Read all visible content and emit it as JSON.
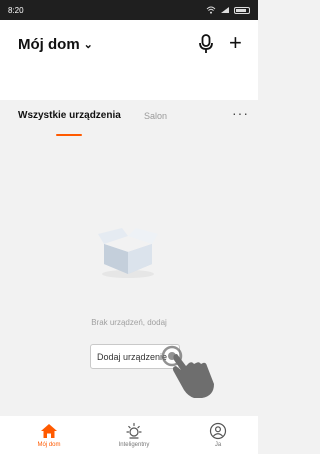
{
  "status_bar": {
    "time": "8:20"
  },
  "header": {
    "home_title": "Mój dom",
    "chevron_glyph": "⌄",
    "plus_glyph": "+"
  },
  "tabs": {
    "items": [
      {
        "label": "Wszystkie urządzenia",
        "active": true
      },
      {
        "label": "Salon",
        "active": false
      }
    ],
    "more_glyph": "···"
  },
  "empty_state": {
    "message": "Brak urządzeń, dodaj",
    "button_label": "Dodaj urządzenie"
  },
  "bottom_nav": [
    {
      "label": "Mój dom",
      "icon": "home-icon",
      "active": true
    },
    {
      "label": "Inteligentny",
      "icon": "sun-icon",
      "active": false
    },
    {
      "label": "Ja",
      "icon": "profile-icon",
      "active": false
    }
  ],
  "colors": {
    "accent": "#ff5a00",
    "header_bg": "#ffffff",
    "page_bg": "#f2f2f2",
    "status_bar": "#1f1f1f"
  }
}
